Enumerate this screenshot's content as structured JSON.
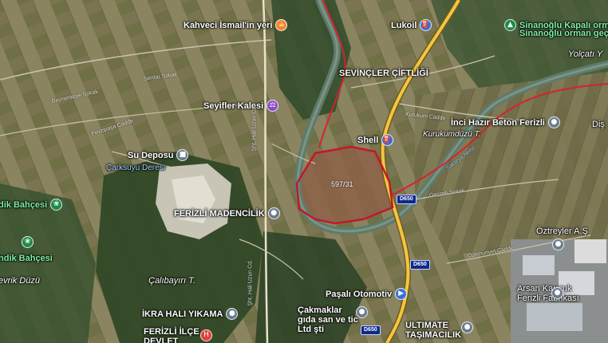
{
  "map": {
    "colors": {
      "parcel_outline": "#c5162b",
      "admin_boundary": "#d8202c",
      "river": "#5f7a6a",
      "highway": "#f4c542"
    },
    "parcel_label": "597/31",
    "pois": {
      "kahveci": "Kahveci İsmail'in yeri",
      "lukoil": "Lukoil",
      "sinanoglu1": "Sinanoğlu Kapalı orman",
      "sinanoglu2": "Sinanoğlu orman geçidi",
      "yolcatti": "Yolçatı Y",
      "sevincler": "SEVİNÇLER ÇİFTLİĞİ",
      "seyifler": "Seyifler Kalesi",
      "shell": "Shell",
      "kurukumduzu": "Kurukumdüzü T.",
      "inci": "İnci Hazır Beton Ferizli",
      "su_deposu": "Su Deposu",
      "carksuyu": "Çarksuyu Deresi",
      "ferizli_madencilik": "FERİZLİ MADENCİLİK",
      "bahcesi1": "dik Bahçesi",
      "bahcesi2": "ndik Bahçesi",
      "devrik": "evrik Düzü",
      "calibayiri": "Çalıbayırı T.",
      "pasali": "Paşalı Otomotiv",
      "cakmaklar": "Çakmaklar gıda san ve tic Ltd şti",
      "ikra": "İKRA HALI YIKAMA",
      "ferizli_hastane": "FERİZLİ İLÇE DEVLET HASTANESİ",
      "ultimate": "ULTIMATE TAŞIMACILIK",
      "arsan": "Arsan Kauçuk Ferizli Fabrikası",
      "oztreyler": "Öztreyler A.Ş",
      "dis": "Diş"
    },
    "roads": {
      "hali_uzun_1": "Şht. Hali Uzun Cd.",
      "hali_uzun_2": "Şht. Hali Uzun Cd.",
      "sakarya": "Sakarya Nehri",
      "kurukum_cd": "Kurukum Cadde",
      "fevzipasa": "Fevzipaşa Cadde",
      "bayramtepe": "Bayramtepe Sokak",
      "serdar": "Serdar Sokak",
      "gecimli": "Geçimli Sokak",
      "cumhuriyet": "Cumhuriyet Cadde"
    },
    "shields": {
      "d650_a": "D650",
      "d650_b": "D650",
      "d650_c": "D650"
    }
  }
}
